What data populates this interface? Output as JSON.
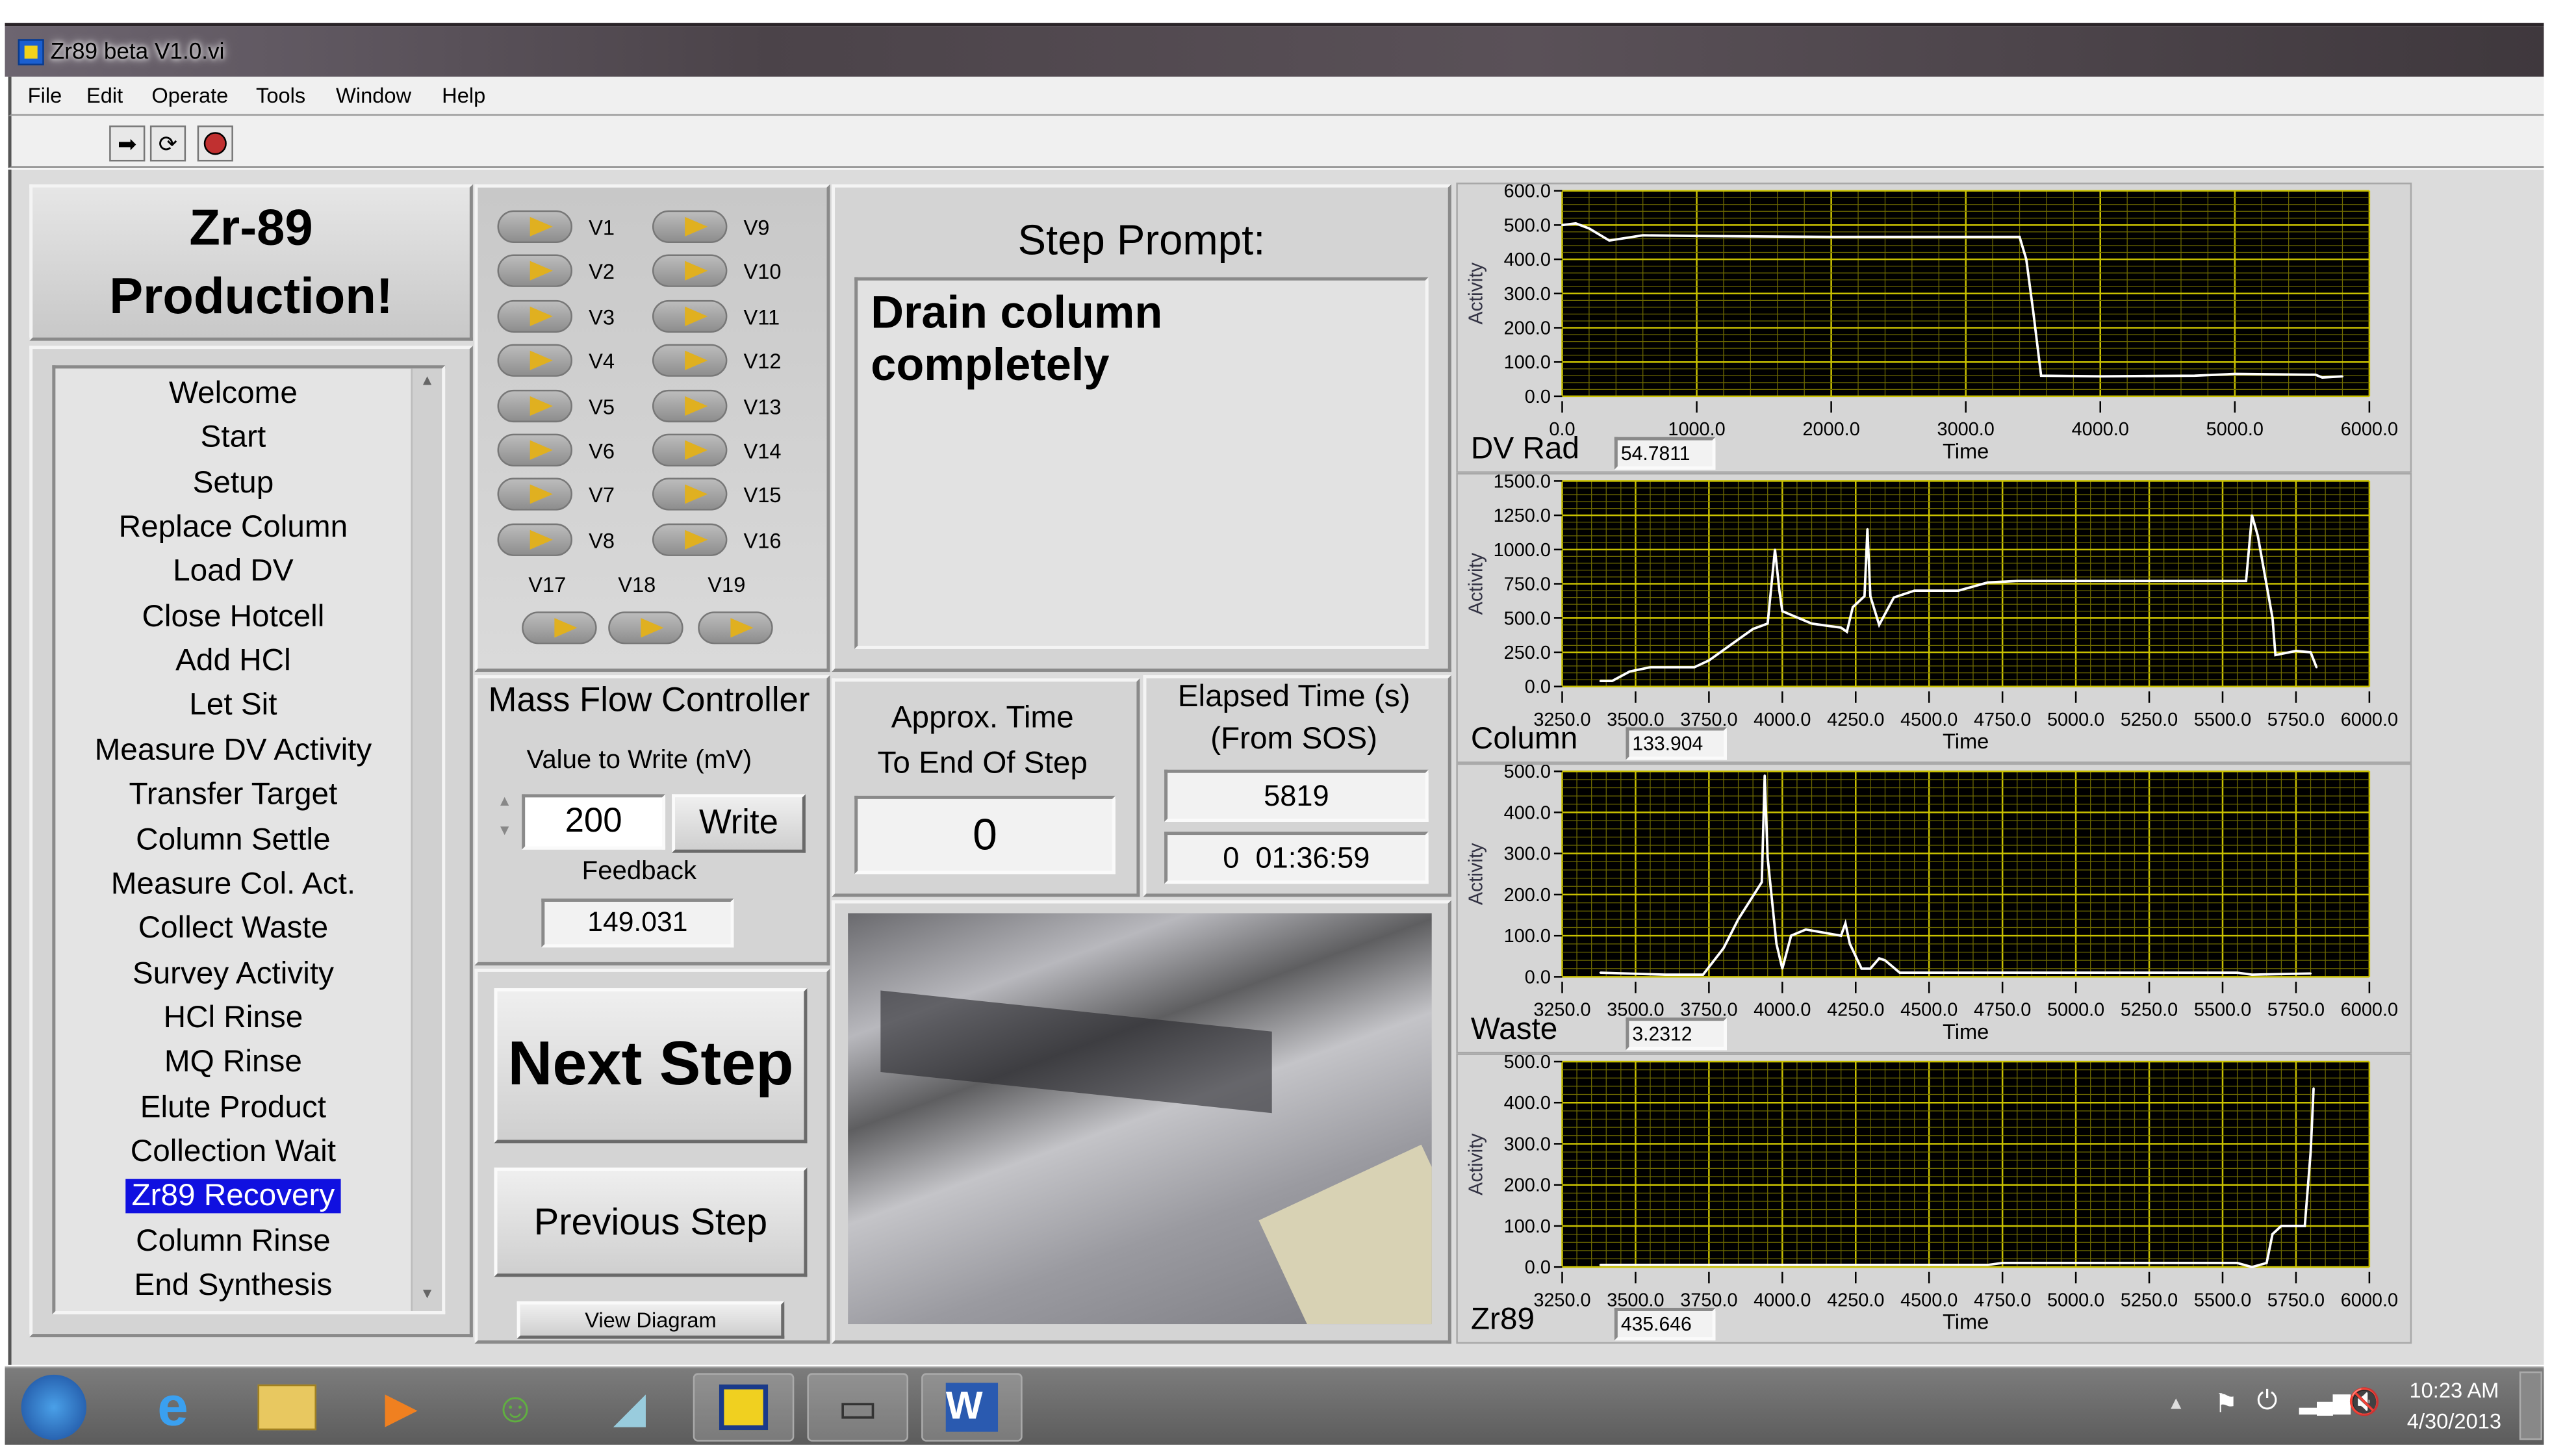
{
  "window": {
    "title": "Zr89 beta V1.0.vi"
  },
  "menu": [
    "File",
    "Edit",
    "Operate",
    "Tools",
    "Window",
    "Help"
  ],
  "toolbar": {
    "run": "run-arrow-icon",
    "run_continuous": "run-continuously-icon",
    "abort": "abort-stop-icon"
  },
  "header": {
    "line1": "Zr-89",
    "line2": "Production!"
  },
  "steps": {
    "items": [
      "Welcome",
      "Start",
      "Setup",
      "Replace Column",
      "Load DV",
      "Close Hotcell",
      "Add HCl",
      "Let Sit",
      "Measure DV Activity",
      "Transfer Target",
      "Column Settle",
      "Measure Col. Act.",
      "Collect Waste",
      "Survey Activity",
      "HCl Rinse",
      "MQ Rinse",
      "Elute Product",
      "Collection Wait",
      "Zr89 Recovery",
      "Column Rinse",
      "End Synthesis"
    ],
    "selected": "Zr89 Recovery"
  },
  "valves": {
    "col1": [
      "V1",
      "V2",
      "V3",
      "V4",
      "V5",
      "V6",
      "V7",
      "V8"
    ],
    "col2": [
      "V9",
      "V10",
      "V11",
      "V12",
      "V13",
      "V14",
      "V15",
      "V16"
    ],
    "bottom": [
      "V17",
      "V18",
      "V19"
    ]
  },
  "prompt": {
    "title": "Step Prompt:",
    "text": "Drain column completely"
  },
  "mfc": {
    "title": "Mass Flow Controller",
    "value_label": "Value to Write (mV)",
    "value": "200",
    "write": "Write",
    "feedback_label": "Feedback",
    "feedback": "149.031"
  },
  "approx": {
    "line1": "Approx. Time",
    "line2": "To End Of Step",
    "value": "0"
  },
  "elapsed": {
    "line1": "Elapsed Time (s)",
    "line2": "(From SOS)",
    "seconds": "5819",
    "clock": "0  01:36:59"
  },
  "buttons": {
    "next": "Next Step",
    "previous": "Previous Step",
    "diagram": "View Diagram"
  },
  "chart_data": [
    {
      "type": "line",
      "name": "DV Rad",
      "readout": "54.7811",
      "xlabel": "Time",
      "ylabel": "Activity",
      "xlim": [
        0,
        6000
      ],
      "xstep": 1000,
      "ylim": [
        0,
        600
      ],
      "ystep": 100,
      "grid": true,
      "x": [
        0,
        100,
        200,
        350,
        600,
        1000,
        2000,
        3000,
        3400,
        3450,
        3500,
        3560,
        4000,
        4700,
        5000,
        5600,
        5650,
        5800
      ],
      "y": [
        500,
        505,
        490,
        455,
        470,
        468,
        465,
        465,
        465,
        400,
        250,
        60,
        58,
        60,
        65,
        63,
        55,
        58
      ]
    },
    {
      "type": "line",
      "name": "Column",
      "readout": "133.904",
      "xlabel": "Time",
      "ylabel": "Activity",
      "xlim": [
        3250,
        6000
      ],
      "xstep": 250,
      "ylim": [
        0,
        1500
      ],
      "ystep": 250,
      "grid": true,
      "x": [
        3380,
        3420,
        3480,
        3550,
        3700,
        3750,
        3900,
        3950,
        3975,
        3990,
        4000,
        4100,
        4200,
        4220,
        4240,
        4280,
        4290,
        4300,
        4330,
        4380,
        4450,
        4600,
        4700,
        4800,
        5580,
        5600,
        5620,
        5670,
        5680,
        5750,
        5800,
        5820
      ],
      "y": [
        40,
        40,
        110,
        140,
        140,
        190,
        420,
        460,
        1000,
        700,
        550,
        460,
        430,
        400,
        580,
        660,
        1150,
        660,
        450,
        650,
        700,
        700,
        760,
        770,
        770,
        1250,
        1100,
        500,
        230,
        260,
        250,
        140
      ]
    },
    {
      "type": "line",
      "name": "Waste",
      "readout": "3.2312",
      "xlabel": "Time",
      "ylabel": "Activity",
      "xlim": [
        3250,
        6000
      ],
      "xstep": 250,
      "ylim": [
        0,
        500
      ],
      "ystep": 100,
      "grid": true,
      "x": [
        3380,
        3600,
        3730,
        3800,
        3850,
        3930,
        3940,
        3950,
        3980,
        4000,
        4030,
        4080,
        4200,
        4215,
        4230,
        4270,
        4300,
        4330,
        4350,
        4400,
        4750,
        5550,
        5600,
        5800
      ],
      "y": [
        10,
        5,
        5,
        70,
        140,
        230,
        490,
        290,
        80,
        20,
        100,
        115,
        100,
        130,
        80,
        20,
        20,
        45,
        40,
        10,
        10,
        10,
        5,
        8
      ]
    },
    {
      "type": "line",
      "name": "Zr89",
      "readout": "435.646",
      "xlabel": "Time",
      "ylabel": "Activity",
      "xlim": [
        3250,
        6000
      ],
      "xstep": 250,
      "ylim": [
        0,
        500
      ],
      "ystep": 100,
      "grid": true,
      "x": [
        3380,
        4700,
        4750,
        5550,
        5600,
        5650,
        5670,
        5700,
        5780,
        5800,
        5810
      ],
      "y": [
        5,
        5,
        10,
        10,
        0,
        10,
        80,
        100,
        100,
        280,
        435
      ]
    }
  ],
  "taskbar": {
    "apps": [
      "start-orb",
      "internet-explorer",
      "file-explorer",
      "media-player",
      "people",
      "network-app",
      "labview",
      "laptop-app",
      "word"
    ],
    "time": "10:23 AM",
    "date": "4/30/2013"
  },
  "colors": {
    "plot_bg": "#000000",
    "grid_major": "#c8c000",
    "grid_minor": "#6e6a00",
    "trace": "#ffffff",
    "selection": "#1010e0"
  }
}
